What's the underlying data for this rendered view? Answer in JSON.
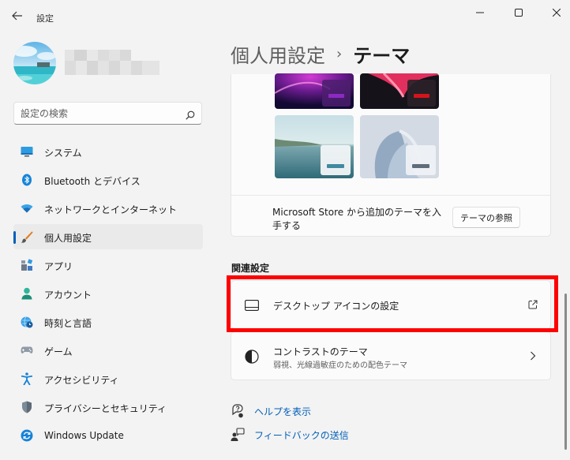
{
  "window": {
    "title": "設定",
    "back_icon": "arrow-left-icon",
    "minimize_icon": "minimize-icon",
    "maximize_icon": "maximize-icon",
    "close_icon": "close-icon"
  },
  "user": {
    "avatar_icon": "user-avatar"
  },
  "search": {
    "placeholder": "設定の検索",
    "icon": "search-icon"
  },
  "sidebar": {
    "items": [
      {
        "label": "システム",
        "icon": "monitor-icon",
        "active": false
      },
      {
        "label": "Bluetooth とデバイス",
        "icon": "bluetooth-icon",
        "active": false
      },
      {
        "label": "ネットワークとインターネット",
        "icon": "wifi-icon",
        "active": false
      },
      {
        "label": "個人用設定",
        "icon": "brush-icon",
        "active": true
      },
      {
        "label": "アプリ",
        "icon": "apps-icon",
        "active": false
      },
      {
        "label": "アカウント",
        "icon": "account-icon",
        "active": false
      },
      {
        "label": "時刻と言語",
        "icon": "clock-globe-icon",
        "active": false
      },
      {
        "label": "ゲーム",
        "icon": "gamepad-icon",
        "active": false
      },
      {
        "label": "アクセシビリティ",
        "icon": "accessibility-icon",
        "active": false
      },
      {
        "label": "プライバシーとセキュリティ",
        "icon": "shield-icon",
        "active": false
      },
      {
        "label": "Windows Update",
        "icon": "windows-update-icon",
        "active": false
      }
    ]
  },
  "header": {
    "parent": "個人用設定",
    "separator": "›",
    "current": "テーマ"
  },
  "themes": {
    "store_text": "Microsoft Store から追加のテーマを入手する",
    "browse_button": "テーマの参照"
  },
  "related": {
    "title": "関連設定",
    "desktop_icons": {
      "title": "デスクトップ アイコンの設定",
      "icon": "desktop-icon",
      "end_icon": "open-external-icon"
    },
    "contrast": {
      "title": "コントラストのテーマ",
      "subtitle": "弱視、光線過敏症のための配色テーマ",
      "icon": "contrast-icon",
      "end_icon": "chevron-right-icon"
    }
  },
  "help": {
    "get_help": "ヘルプを表示",
    "feedback": "フィードバックの送信"
  },
  "colors": {
    "accent": "#005fb8",
    "highlight": "#ff0000"
  }
}
